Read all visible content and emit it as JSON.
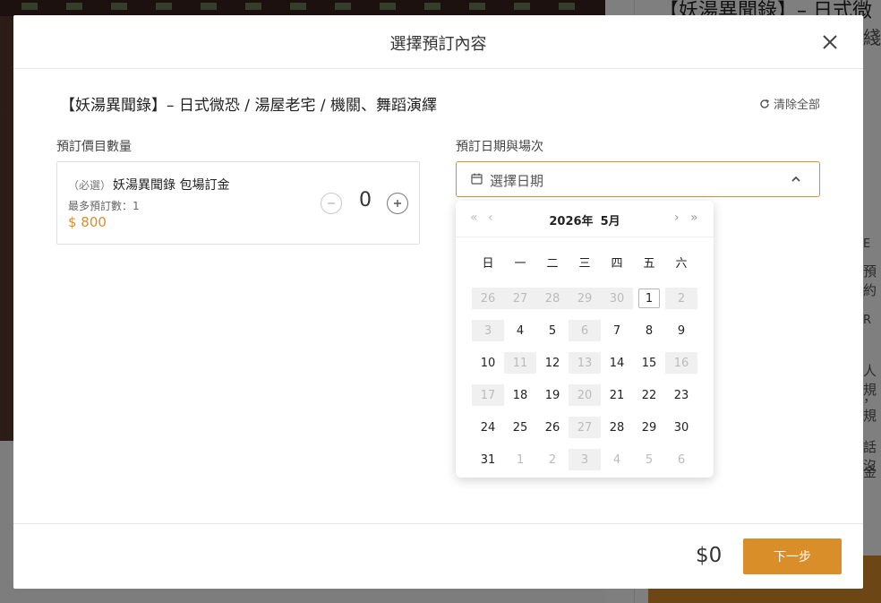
{
  "background": {
    "title_fragment": "【妖湯異聞錄】– 日式微",
    "fragments": [
      "綫",
      "E",
      "預約",
      "R",
      "人規",
      "，規",
      "話沒",
      "金"
    ]
  },
  "modal": {
    "title": "選擇預訂內容",
    "event_title": "【妖湯異聞錄】– 日式微恐 / 湯屋老宅 / 機關、舞蹈演繹",
    "clear_all": "清除全部",
    "left_label": "預訂價目數量",
    "right_label": "預訂日期與場次"
  },
  "ticket": {
    "required_tag": "（必選）",
    "name": "妖湯異聞錄 包場訂金",
    "max_booking": "最多預訂數：1",
    "price": "$ 800",
    "quantity": "0"
  },
  "date_picker": {
    "placeholder": "選擇日期",
    "year": "2026年",
    "month": "5月",
    "weekdays": [
      "日",
      "一",
      "二",
      "三",
      "四",
      "五",
      "六"
    ],
    "nav": {
      "prev_year": "«",
      "prev_month": "‹",
      "next_month": "›",
      "next_year": "»"
    },
    "days": [
      {
        "d": "26",
        "s": "other-disabled"
      },
      {
        "d": "27",
        "s": "other-disabled"
      },
      {
        "d": "28",
        "s": "other-disabled"
      },
      {
        "d": "29",
        "s": "other-disabled"
      },
      {
        "d": "30",
        "s": "other-disabled"
      },
      {
        "d": "1",
        "s": "today"
      },
      {
        "d": "2",
        "s": "disabled"
      },
      {
        "d": "3",
        "s": "disabled"
      },
      {
        "d": "4",
        "s": "normal"
      },
      {
        "d": "5",
        "s": "normal"
      },
      {
        "d": "6",
        "s": "disabled"
      },
      {
        "d": "7",
        "s": "normal"
      },
      {
        "d": "8",
        "s": "normal"
      },
      {
        "d": "9",
        "s": "normal"
      },
      {
        "d": "10",
        "s": "normal"
      },
      {
        "d": "11",
        "s": "disabled"
      },
      {
        "d": "12",
        "s": "normal"
      },
      {
        "d": "13",
        "s": "disabled"
      },
      {
        "d": "14",
        "s": "normal"
      },
      {
        "d": "15",
        "s": "normal"
      },
      {
        "d": "16",
        "s": "disabled"
      },
      {
        "d": "17",
        "s": "disabled"
      },
      {
        "d": "18",
        "s": "normal"
      },
      {
        "d": "19",
        "s": "normal"
      },
      {
        "d": "20",
        "s": "disabled"
      },
      {
        "d": "21",
        "s": "normal"
      },
      {
        "d": "22",
        "s": "normal"
      },
      {
        "d": "23",
        "s": "normal"
      },
      {
        "d": "24",
        "s": "normal"
      },
      {
        "d": "25",
        "s": "normal"
      },
      {
        "d": "26",
        "s": "normal"
      },
      {
        "d": "27",
        "s": "disabled"
      },
      {
        "d": "28",
        "s": "normal"
      },
      {
        "d": "29",
        "s": "normal"
      },
      {
        "d": "30",
        "s": "normal"
      },
      {
        "d": "31",
        "s": "normal"
      },
      {
        "d": "1",
        "s": "other"
      },
      {
        "d": "2",
        "s": "other"
      },
      {
        "d": "3",
        "s": "other-disabled"
      },
      {
        "d": "4",
        "s": "other"
      },
      {
        "d": "5",
        "s": "other"
      },
      {
        "d": "6",
        "s": "other"
      }
    ]
  },
  "footer": {
    "total": "$0",
    "next_label": "下一步"
  },
  "colors": {
    "accent": "#d98e2a",
    "disabled_bg": "#f0f0f0",
    "overlay": "rgba(0,0,0,0.5)"
  }
}
